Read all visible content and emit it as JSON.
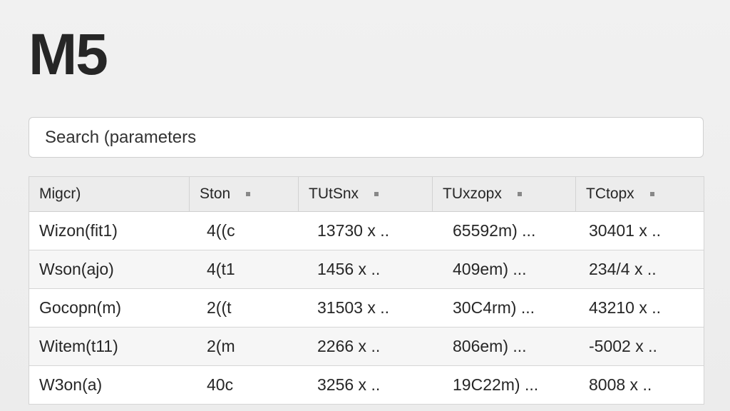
{
  "page": {
    "title": "M5"
  },
  "search": {
    "value": "Search (parameters"
  },
  "table": {
    "columns": [
      {
        "label": "Migcr)",
        "sortable": false
      },
      {
        "label": "Ston",
        "sortable": true
      },
      {
        "label": "TUtSnx",
        "sortable": true
      },
      {
        "label": "TUxzopx",
        "sortable": true
      },
      {
        "label": "TCtopx",
        "sortable": true
      }
    ],
    "rows": [
      [
        "Wizon(fit1)",
        "4((c",
        "13730 x ..",
        "65592m) ...",
        "30401 x .."
      ],
      [
        "Wson(ajo)",
        "4(t1",
        "1456 x ..",
        "409em) ...",
        "234/4 x .."
      ],
      [
        "Gocopn(m)",
        "2((t",
        "31503 x ..",
        "30C4rm) ...",
        "43210 x .."
      ],
      [
        "Witem(t11)",
        "2(m",
        "2266 x ..",
        "806em) ...",
        "-5002 x .."
      ],
      [
        "W3on(a)",
        "40c",
        "3256 x ..",
        "19C22m) ...",
        "8008 x .."
      ]
    ]
  }
}
